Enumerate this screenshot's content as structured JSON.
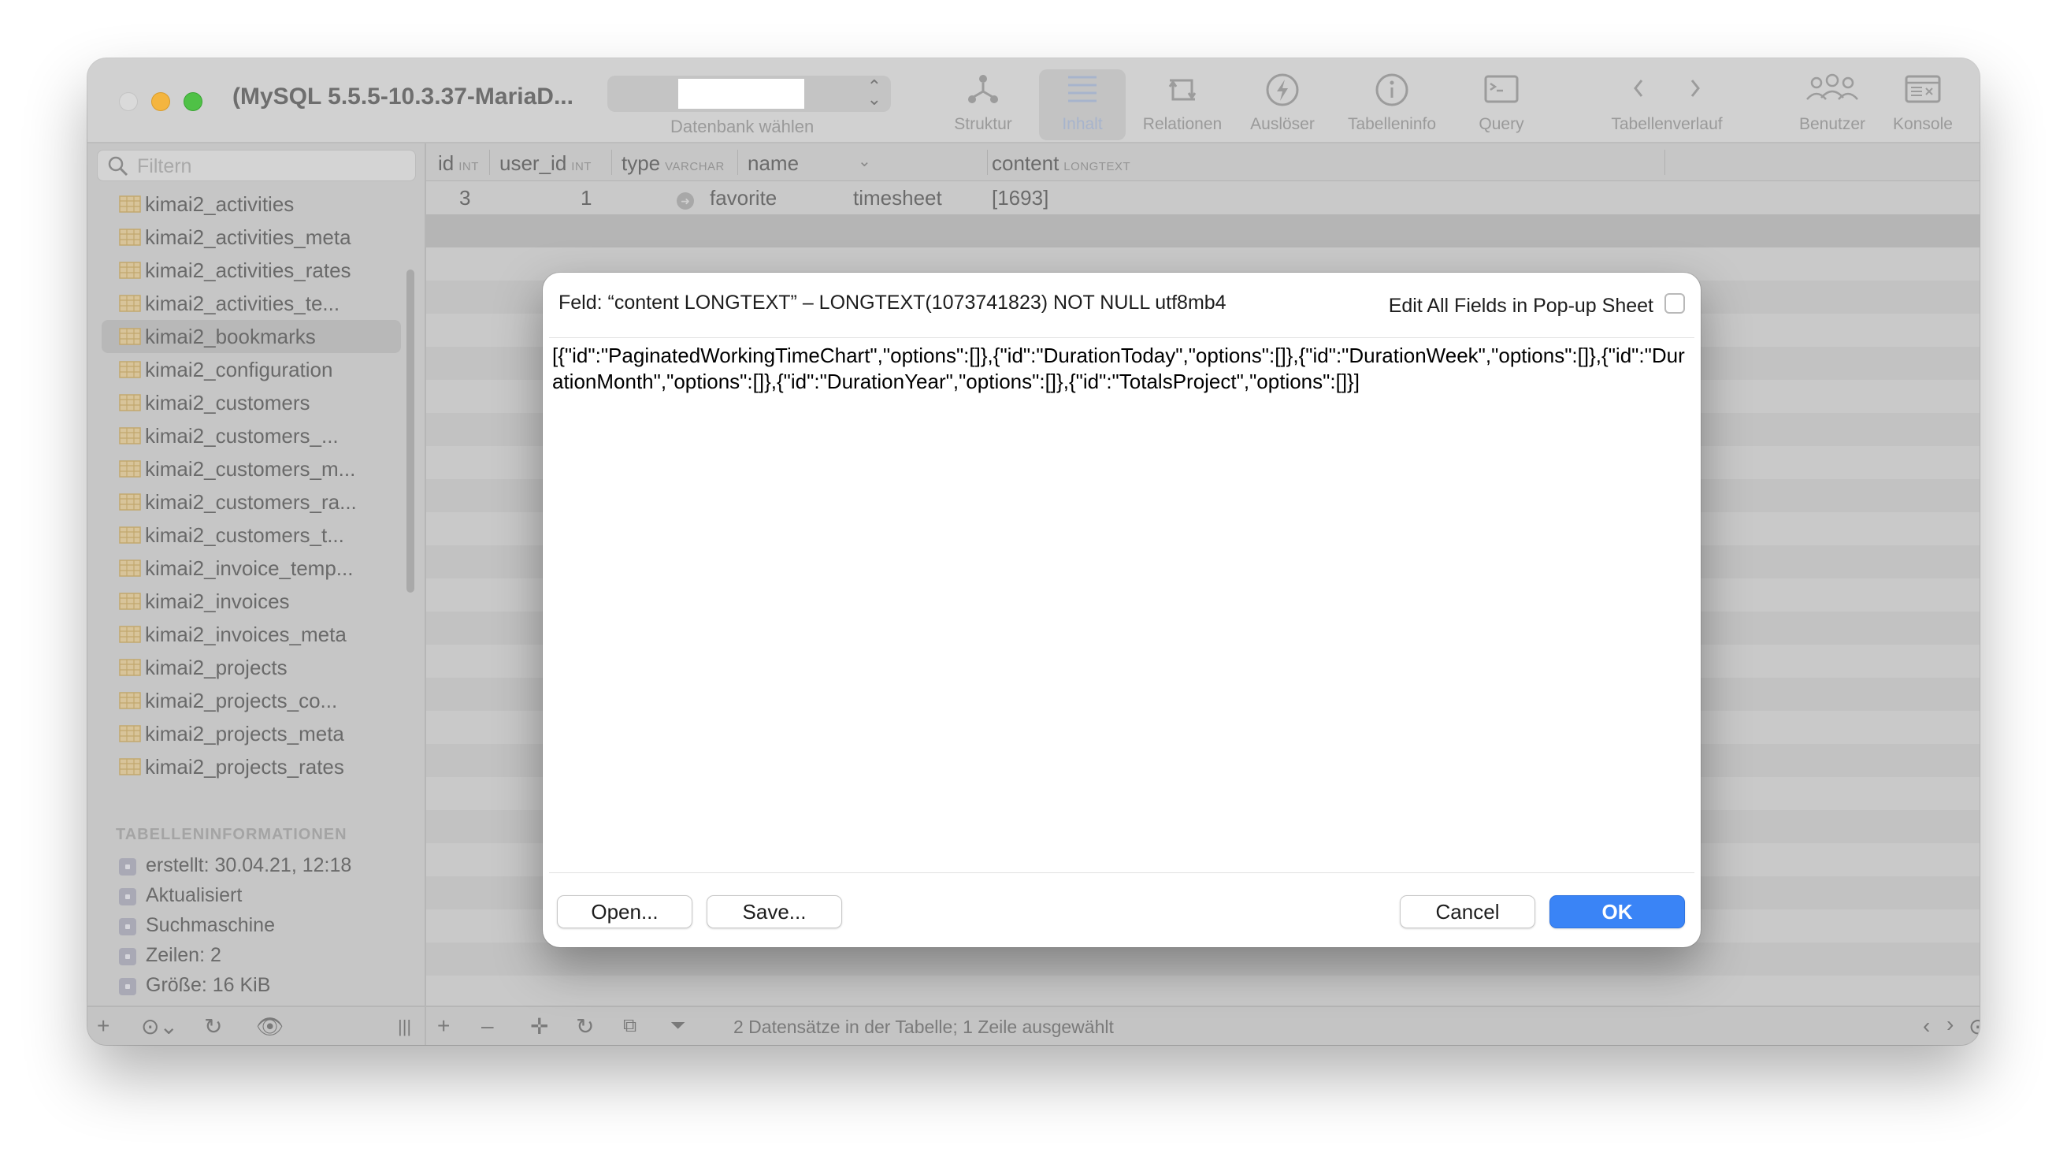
{
  "window": {
    "title": "(MySQL 5.5.5-10.3.37-MariaD...",
    "db_selector_label": "Datenbank wählen"
  },
  "toolbar": {
    "items": [
      {
        "label": "Struktur",
        "icon": "structure-icon"
      },
      {
        "label": "Inhalt",
        "icon": "content-icon",
        "active": true
      },
      {
        "label": "Relationen",
        "icon": "relations-icon"
      },
      {
        "label": "Auslöser",
        "icon": "trigger-icon"
      },
      {
        "label": "Tabelleninfo",
        "icon": "info-icon"
      },
      {
        "label": "Query",
        "icon": "query-icon"
      },
      {
        "label": "Tabellenverlauf",
        "icon": "history-nav-icon"
      },
      {
        "label": "Benutzer",
        "icon": "users-icon"
      },
      {
        "label": "Konsole",
        "icon": "console-icon"
      }
    ]
  },
  "sidebar": {
    "filter_placeholder": "Filtern",
    "tables": [
      "kimai2_activities",
      "kimai2_activities_meta",
      "kimai2_activities_rates",
      "kimai2_activities_te...",
      "kimai2_bookmarks",
      "kimai2_configuration",
      "kimai2_customers",
      "kimai2_customers_...",
      "kimai2_customers_m...",
      "kimai2_customers_ra...",
      "kimai2_customers_t...",
      "kimai2_invoice_temp...",
      "kimai2_invoices",
      "kimai2_invoices_meta",
      "kimai2_projects",
      "kimai2_projects_co...",
      "kimai2_projects_meta",
      "kimai2_projects_rates"
    ],
    "selected_table": "kimai2_bookmarks",
    "info_heading": "TABELLENINFORMATIONEN",
    "info_items": [
      "erstellt: 30.04.21, 12:18",
      "Aktualisiert",
      "Suchmaschine",
      "Zeilen: 2",
      "Größe: 16 KiB"
    ]
  },
  "table": {
    "columns": [
      {
        "name": "id",
        "type": "INT"
      },
      {
        "name": "user_id",
        "type": "INT"
      },
      {
        "name": "type",
        "type": "VARCHAR"
      },
      {
        "name": "name",
        "type": ""
      },
      {
        "name": "content",
        "type": "LONGTEXT"
      }
    ],
    "rows": [
      {
        "id": "3",
        "user_id": "1",
        "type": "favorite",
        "name": "timesheet",
        "content": "[1693]"
      }
    ]
  },
  "status_bar": {
    "text": "2 Datensätze in der Tabelle; 1 Zeile ausgewählt"
  },
  "dialog": {
    "field_label": "Feld: “content LONGTEXT” – LONGTEXT(1073741823) NOT NULL utf8mb4",
    "edit_all_label": "Edit All Fields in Pop-up Sheet",
    "edit_all_checked": false,
    "content": "[{\"id\":\"PaginatedWorkingTimeChart\",\"options\":[]},{\"id\":\"DurationToday\",\"options\":[]},{\"id\":\"DurationWeek\",\"options\":[]},{\"id\":\"DurationMonth\",\"options\":[]},{\"id\":\"DurationYear\",\"options\":[]},{\"id\":\"TotalsProject\",\"options\":[]}]",
    "open_label": "Open...",
    "save_label": "Save...",
    "cancel_label": "Cancel",
    "ok_label": "OK"
  },
  "colors": {
    "accent": "#3a84f6",
    "close": "#dadada",
    "minimize": "#f4b53f",
    "maximize": "#4fc146"
  }
}
